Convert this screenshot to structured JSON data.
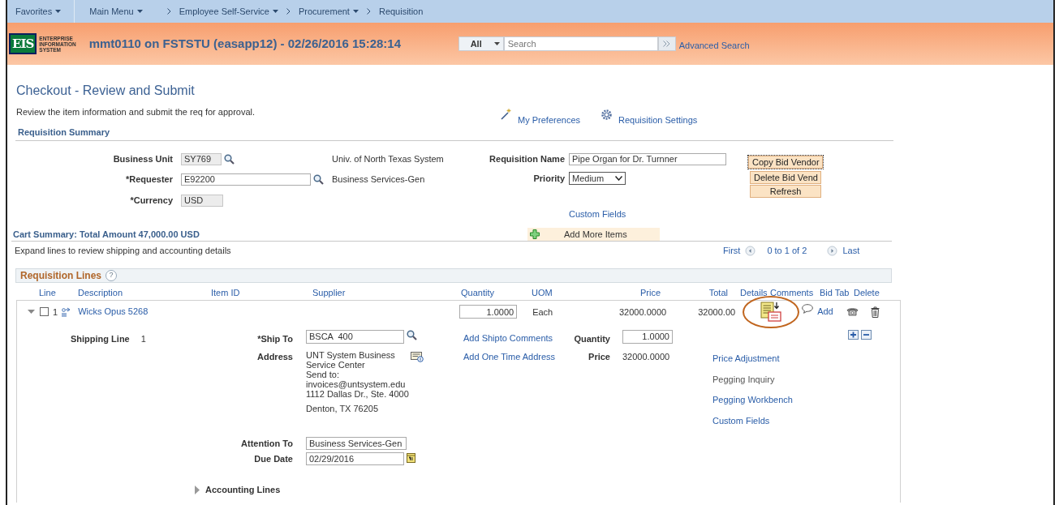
{
  "nav": [
    {
      "label": "Favorites",
      "dropdown": true,
      "separator_before": false
    },
    {
      "label": "Main Menu",
      "dropdown": true,
      "separator_before": false
    },
    {
      "label": "Employee Self-Service",
      "dropdown": true,
      "separator_before": true
    },
    {
      "label": "Procurement",
      "dropdown": true,
      "separator_before": true
    },
    {
      "label": "Requisition",
      "dropdown": false,
      "separator_before": true
    }
  ],
  "header": {
    "logo_mark": "EIS",
    "logo_words": [
      "ENTERPRISE",
      "INFORMATION",
      "SYSTEM"
    ],
    "title": "mmt0110 on FSTSTU (easapp12) - 02/26/2016 15:28:14",
    "search_scope": "All",
    "search_placeholder": "Search",
    "advanced_search": "Advanced Search"
  },
  "page": {
    "title": "Checkout - Review and Submit",
    "description": "Review the item information and submit the req for approval.",
    "preferences_link": "My Preferences",
    "settings_link": "Requisition Settings"
  },
  "summary": {
    "heading": "Requisition Summary",
    "fields": [
      {
        "label": "Business Unit",
        "value": "SY769",
        "editable": false,
        "lookup": true,
        "description": "Univ. of North Texas System"
      },
      {
        "label": "*Requester",
        "value": "E92200",
        "editable": true,
        "lookup": true,
        "description": "Business Services-Gen"
      },
      {
        "label": "*Currency",
        "value": "USD",
        "editable": false,
        "lookup": false
      }
    ],
    "name_label": "Requisition Name",
    "name_value": "Pipe Organ for Dr. Turnner",
    "priority_label": "Priority",
    "priority_value": "Medium",
    "custom_fields": "Custom Fields",
    "buttons": [
      "Copy Bid Vendor",
      "Delete Bid Vend",
      "Refresh"
    ]
  },
  "cart": {
    "summary": "Cart Summary: Total Amount 47,000.00 USD",
    "add_button": "Add More Items",
    "hint": "Expand lines to review shipping and accounting details",
    "first": "First",
    "range": "0 to 1 of 2",
    "last": "Last"
  },
  "lines": {
    "heading": "Requisition Lines",
    "help": "?",
    "columns": [
      "Line",
      "Description",
      "Item ID",
      "Supplier",
      "Quantity",
      "UOM",
      "Price",
      "Total",
      "Details",
      "Comments",
      "Bid Tab",
      "Delete"
    ],
    "rows": [
      {
        "expanded": true,
        "checked": false,
        "line": "1",
        "description": "Wicks Opus 5268",
        "quantity": "1.0000",
        "uom": "Each",
        "price": "32000.0000",
        "total": "32000.00",
        "details_highlighted": true,
        "comments": "Add",
        "shipping": {
          "label": "Shipping Line",
          "number": "1",
          "ship_to_label": "*Ship To",
          "ship_to": "BSCA  400",
          "address_label": "Address",
          "address": [
            "UNT System Business",
            "Service Center",
            "Send to:",
            "invoices@untsystem.edu",
            "1112 Dallas Dr., Ste. 4000",
            "Denton, TX  76205"
          ],
          "shipto_comments": "Add Shipto Comments",
          "one_time_address": "Add One Time Address",
          "quantity_label": "Quantity",
          "quantity": "1.0000",
          "price_label": "Price",
          "price": "32000.0000",
          "actions": [
            {
              "label": "Price Adjustment",
              "enabled": true
            },
            {
              "label": "Pegging Inquiry",
              "enabled": false
            },
            {
              "label": "Pegging Workbench",
              "enabled": true
            },
            {
              "label": "Custom Fields",
              "enabled": true
            }
          ],
          "attention_label": "Attention To",
          "attention": "Business Services-Gen",
          "due_label": "Due Date",
          "due_date": "02/29/2016"
        },
        "accounting": {
          "label": "Accounting Lines",
          "expanded": false
        }
      }
    ]
  }
}
